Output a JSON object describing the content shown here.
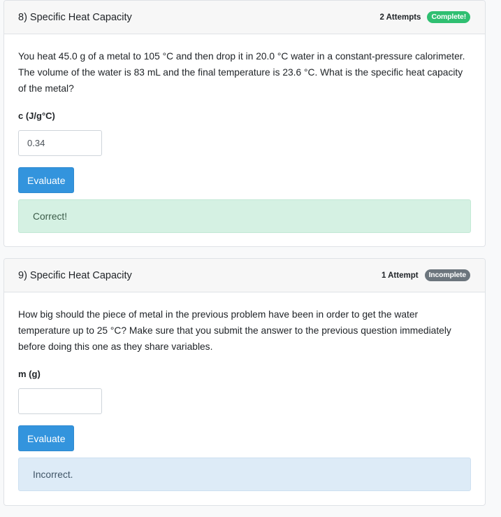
{
  "problems": [
    {
      "title": "8) Specific Heat Capacity",
      "attempts": "2 Attempts",
      "status": "Complete!",
      "status_color": "#2fbf71",
      "question": "You heat 45.0 g of a metal to 105 °C and then drop it in 20.0 °C water in a constant-pressure calorimeter. The volume of the water is 83 mL and the final temperature is 23.6 °C.  What is the specific heat capacity of the metal?",
      "field_label": "c (J/g°C)",
      "answer_value": "0.34",
      "answer_placeholder": "",
      "button_label": "Evaluate",
      "feedback": "Correct!",
      "feedback_color": "#d5f1e3"
    },
    {
      "title": "9) Specific Heat Capacity",
      "attempts": "1 Attempt",
      "status": "Incomplete",
      "status_color": "#6c757d",
      "question": "How big should the piece of metal in the previous problem have been in order to get the water temperature up to 25 °C? Make sure that you submit the answer to the previous question immediately before doing this one as they share variables.",
      "field_label": "m (g)",
      "answer_value": "",
      "answer_placeholder": "",
      "button_label": "Evaluate",
      "feedback": "Incorrect.",
      "feedback_color": "#ddebf7"
    }
  ],
  "colors": {
    "button": "#3394dd",
    "header_bg": "#f7f7f7",
    "border": "#dfe2e6"
  }
}
